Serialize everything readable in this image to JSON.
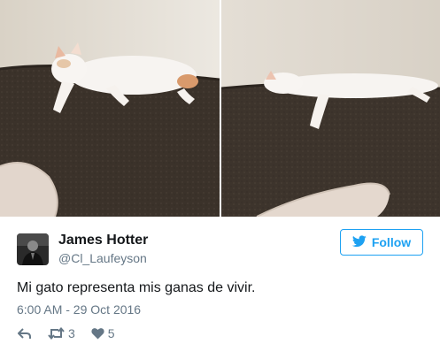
{
  "author": {
    "display_name": "James Hotter",
    "handle": "@Cl_Laufeyson"
  },
  "follow_button": {
    "label": "Follow",
    "icon": "twitter-bird-icon"
  },
  "tweet": {
    "text": "Mi gato representa mis ganas de vivir.",
    "timestamp": "6:00 AM - 29 Oct 2016"
  },
  "actions": {
    "reply_icon": "reply-icon",
    "retweet_icon": "retweet-icon",
    "retweet_count": "3",
    "like_icon": "heart-icon",
    "like_count": "5"
  },
  "colors": {
    "accent": "#1da1f2",
    "text": "#14171a",
    "muted": "#657786"
  }
}
